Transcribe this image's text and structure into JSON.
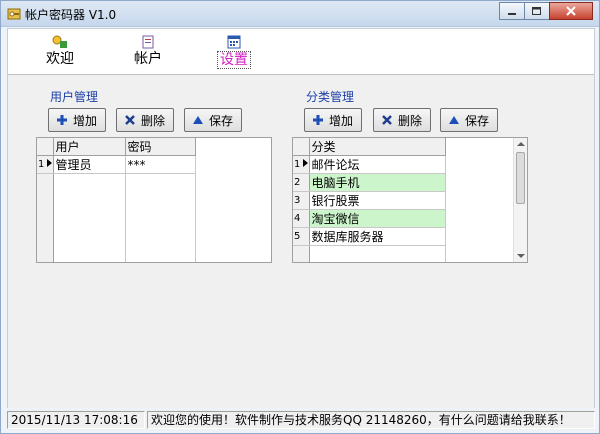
{
  "window": {
    "title": "帐户密码器 V1.0"
  },
  "tabs": [
    {
      "label": "欢迎"
    },
    {
      "label": "帐户"
    },
    {
      "label": "设置"
    }
  ],
  "user_group": {
    "label": "用户管理",
    "buttons": {
      "add": "增加",
      "delete": "删除",
      "save": "保存"
    },
    "columns": [
      "用户",
      "密码"
    ],
    "rows": [
      {
        "index": "1",
        "user": "管理员",
        "password": "***"
      }
    ]
  },
  "category_group": {
    "label": "分类管理",
    "buttons": {
      "add": "增加",
      "delete": "删除",
      "save": "保存"
    },
    "columns": [
      "分类"
    ],
    "rows": [
      {
        "index": "1",
        "name": "邮件论坛"
      },
      {
        "index": "2",
        "name": "电脑手机"
      },
      {
        "index": "3",
        "name": "银行股票"
      },
      {
        "index": "4",
        "name": "淘宝微信"
      },
      {
        "index": "5",
        "name": "数据库服务器"
      }
    ]
  },
  "status": {
    "datetime": "2015/11/13 17:08:16",
    "message": "欢迎您的使用！软件制作与技术服务QQ 21148260，有什么问题请给我联系！"
  },
  "colors": {
    "active_tab": "#d020c0",
    "group_label": "#1b3fa8",
    "alt_row": "#ccf5cc",
    "add_icon": "#1e4db8",
    "delete_icon": "#1e3f8c"
  }
}
